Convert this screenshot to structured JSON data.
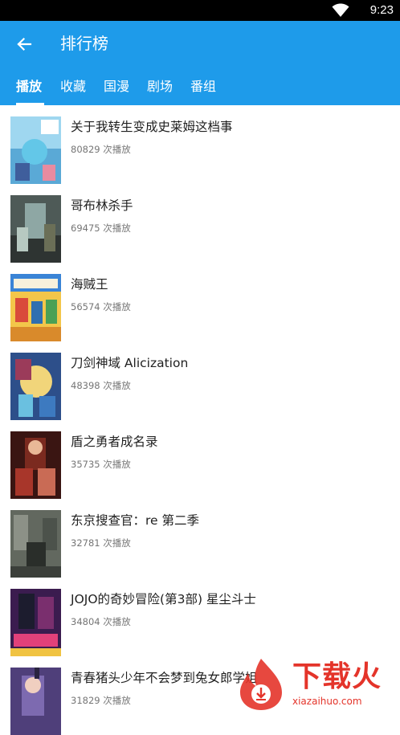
{
  "status_bar": {
    "time": "9:23",
    "wifi_icon": "wifi-icon"
  },
  "app_bar": {
    "back_icon": "back-arrow-icon",
    "title": "排行榜",
    "background_color": "#1e9bea"
  },
  "tabs": [
    {
      "label": "播放",
      "active": true
    },
    {
      "label": "收藏",
      "active": false
    },
    {
      "label": "国漫",
      "active": false
    },
    {
      "label": "剧场",
      "active": false
    },
    {
      "label": "番组",
      "active": false
    }
  ],
  "items": [
    {
      "title": "关于我转生变成史莱姆这档事",
      "count": "80829 次播放"
    },
    {
      "title": "哥布林杀手",
      "count": "69475 次播放"
    },
    {
      "title": "海贼王",
      "count": "56574 次播放"
    },
    {
      "title": "刀剑神域 Alicization",
      "count": "48398 次播放"
    },
    {
      "title": "盾之勇者成名录",
      "count": "35735 次播放"
    },
    {
      "title": "东京搜查官：re 第二季",
      "count": "32781 次播放"
    },
    {
      "title": "JOJO的奇妙冒险(第3部) 星尘斗士",
      "count": "34804 次播放"
    },
    {
      "title": "青春猪头少年不会梦到兔女郎学姐",
      "count": "31829 次播放"
    }
  ],
  "watermark": {
    "text": "下载火",
    "sub": "xiazaihuo.com",
    "color": "#e4342a"
  }
}
